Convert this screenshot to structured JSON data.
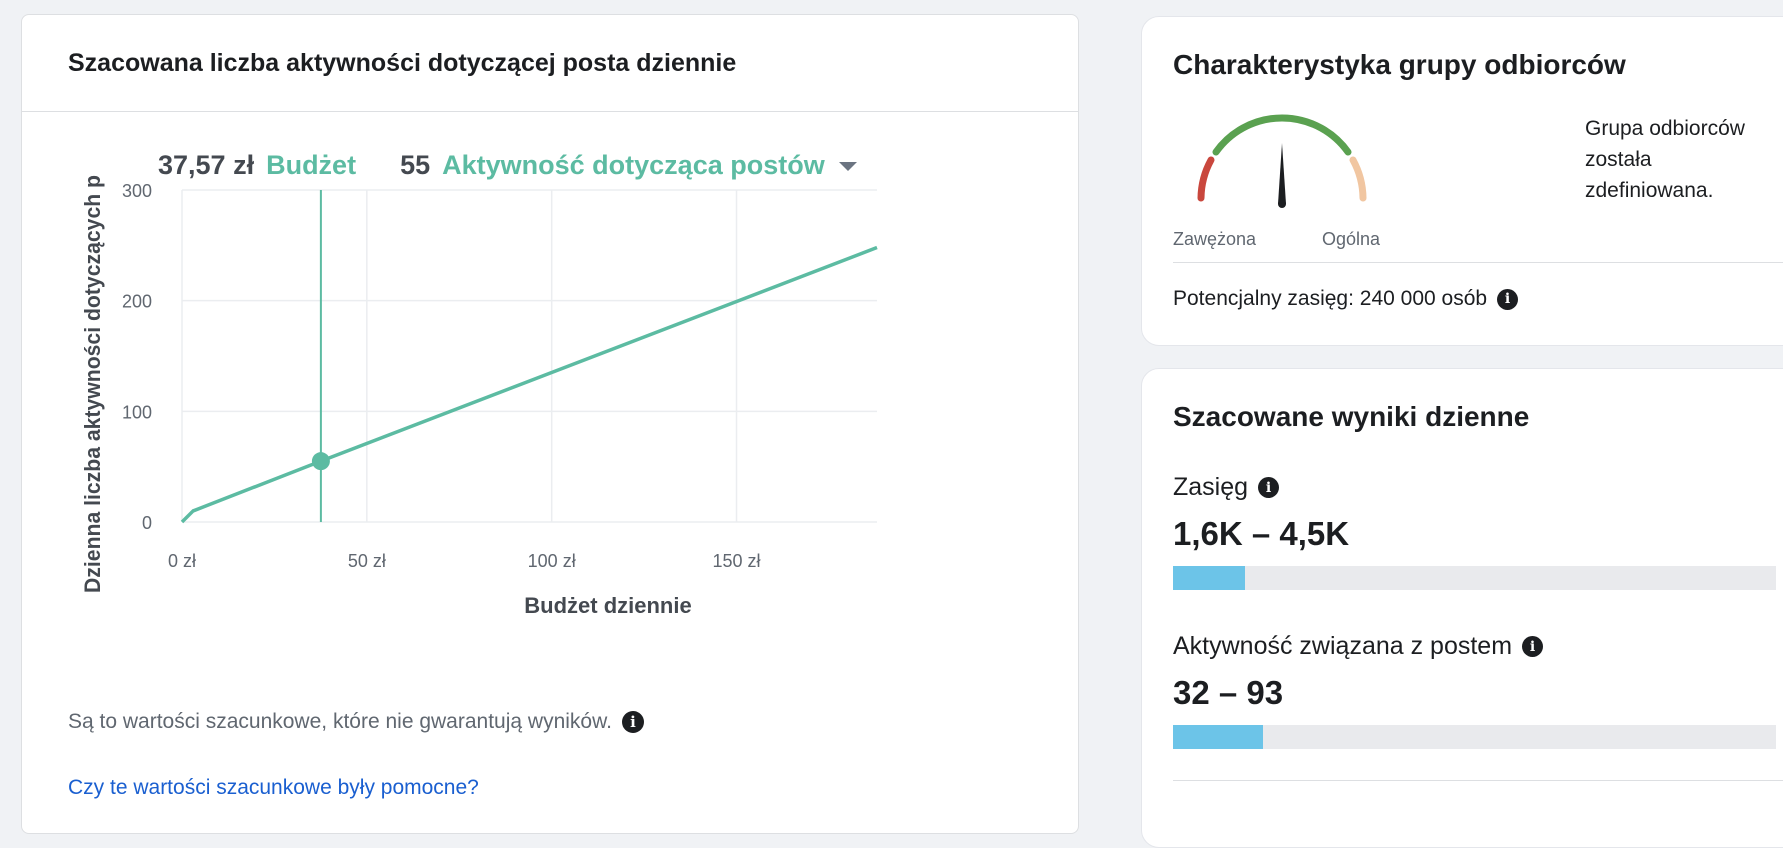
{
  "left_panel": {
    "title": "Szacowana liczba aktywności dotyczącej posta dziennie",
    "summary": {
      "budget_value": "37,57 zł",
      "budget_label": "Budżet",
      "metric_value": "55",
      "metric_label": "Aktywność dotycząca postów"
    },
    "note": "Są to wartości szacunkowe, które nie gwarantują wyników.",
    "feedback_link": "Czy te wartości szacunkowe były pomocne?"
  },
  "chart_data": {
    "type": "line",
    "title": "",
    "xlabel": "Budżet dziennie",
    "ylabel": "Dzienna liczba aktywności dotyczących p",
    "xlim": [
      0,
      188
    ],
    "ylim": [
      0,
      300
    ],
    "x_ticks": [
      0,
      50,
      100,
      150
    ],
    "x_tick_labels": [
      "0 zł",
      "50 zł",
      "100 zł",
      "150 zł"
    ],
    "y_ticks": [
      0,
      100,
      200,
      300
    ],
    "y_tick_labels": [
      "0",
      "100",
      "200",
      "300"
    ],
    "grid": true,
    "series": [
      {
        "x": [
          0,
          3,
          37.57,
          188
        ],
        "y": [
          0,
          10,
          55,
          248
        ]
      }
    ],
    "highlight": {
      "x": 37.57,
      "y": 55
    },
    "colors": {
      "line": "#5cbba2",
      "grid": "#ebedf0",
      "tick_text": "#606770",
      "axis_label": "#444950"
    }
  },
  "audience_panel": {
    "title": "Charakterystyka grupy odbiorców",
    "gauge_left_label": "Zawężona",
    "gauge_right_label": "Ogólna",
    "description": "Grupa odbiorców została zdefiniowana.",
    "reach": "Potencjalny zasięg: 240 000 osób"
  },
  "results_panel": {
    "title": "Szacowane wyniki dzienne",
    "metrics": [
      {
        "label": "Zasięg",
        "value": "1,6K – 4,5K",
        "fill": 0.12
      },
      {
        "label": "Aktywność związana z postem",
        "value": "32 – 93",
        "fill": 0.15
      }
    ]
  },
  "icons": {
    "info": "info-icon",
    "caret": "caret-down-icon"
  },
  "colors": {
    "accent": "#5cbba2",
    "link": "#1a5fd0",
    "bar_fill": "#6cc4e8",
    "bar_track": "#e9eaed"
  }
}
